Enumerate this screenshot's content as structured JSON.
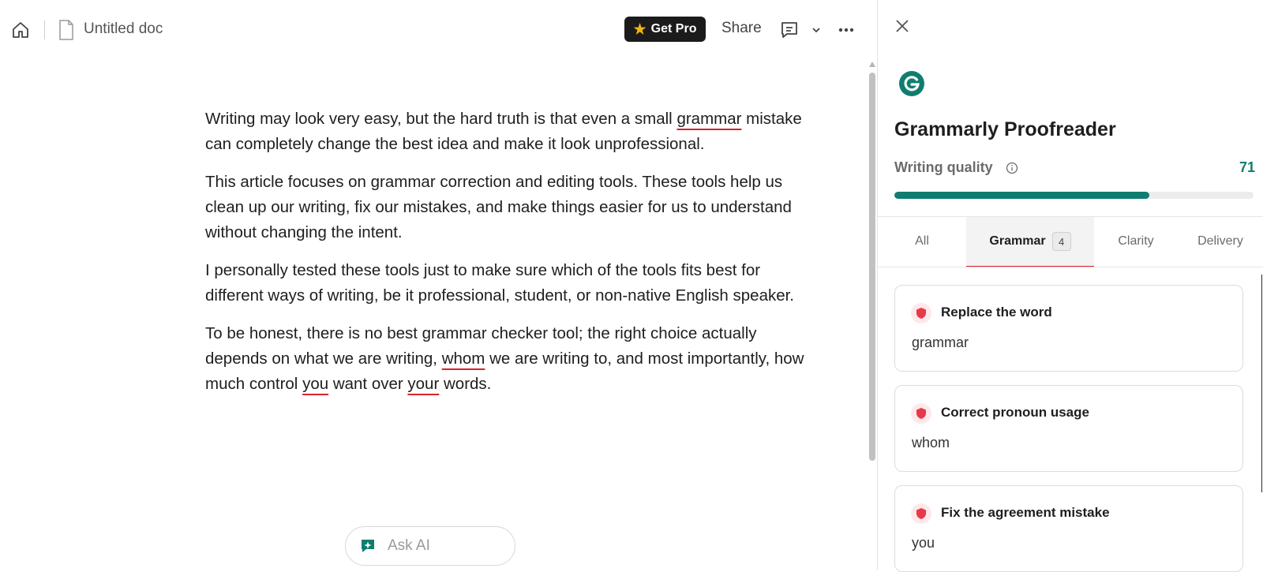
{
  "header": {
    "doc_title": "Untitled doc",
    "get_pro_label": "Get Pro",
    "share_label": "Share"
  },
  "document": {
    "p1": {
      "pre": "Writing may look very easy, but the hard truth is that even a small ",
      "flag1": "grammar",
      "post": " mistake can completely change the best idea and make it look unprofessional."
    },
    "p2": "This article focuses on grammar correction and editing tools. These tools help us clean up our writing, fix our mistakes, and make things easier for us to understand without changing the intent.",
    "p3": "I personally tested these tools just to make sure which of the tools fits best for different ways of writing, be it professional, student, or non-native English speaker.",
    "p4": {
      "a": "To be honest, there is no best grammar checker tool; the right choice actually depends on what we are writing, ",
      "flag1": "whom",
      "b": " we are writing to, and most importantly, how much control ",
      "flag2": "you",
      "c": " want over ",
      "flag3": "your",
      "d": " words."
    }
  },
  "ask_ai": {
    "placeholder": "Ask AI"
  },
  "panel": {
    "title": "Grammarly Proofreader",
    "writing_quality_label": "Writing quality",
    "writing_quality_score": "71",
    "writing_quality_fraction": 0.71,
    "accent_color": "#0f7d70",
    "error_color": "#d9212e",
    "tabs": [
      {
        "label": "All"
      },
      {
        "label": "Grammar",
        "badge": "4"
      },
      {
        "label": "Clarity"
      },
      {
        "label": "Delivery"
      }
    ],
    "cards": [
      {
        "title": "Replace the word",
        "word": "grammar"
      },
      {
        "title": "Correct pronoun usage",
        "word": "whom"
      },
      {
        "title": "Fix the agreement mistake",
        "word": "you"
      }
    ]
  }
}
